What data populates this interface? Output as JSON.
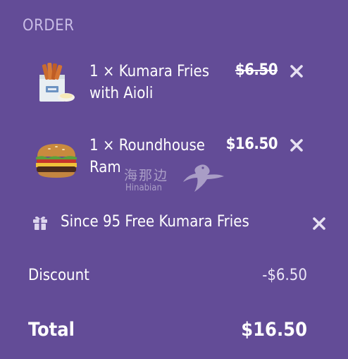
{
  "header": {
    "title": "ORDER"
  },
  "items": [
    {
      "name": "1 × Kumara Fries with Aioli",
      "price": "$6.50",
      "price_struck": true,
      "image_icon": "kumara-fries-icon"
    },
    {
      "name": "1 × Roundhouse Ram",
      "price": "$16.50",
      "price_struck": false,
      "image_icon": "burger-icon"
    }
  ],
  "promo": {
    "icon": "gift-icon",
    "label": "Since 95 Free Kumara Fries"
  },
  "summary": {
    "discount_label": "Discount",
    "discount_value": "-$6.50",
    "total_label": "Total",
    "total_value": "$16.50"
  },
  "watermark": {
    "cn": "海那边",
    "en": "Hinabian"
  },
  "colors": {
    "background": "#634c97",
    "header_text": "#c9bde6",
    "text": "#ffffff"
  }
}
